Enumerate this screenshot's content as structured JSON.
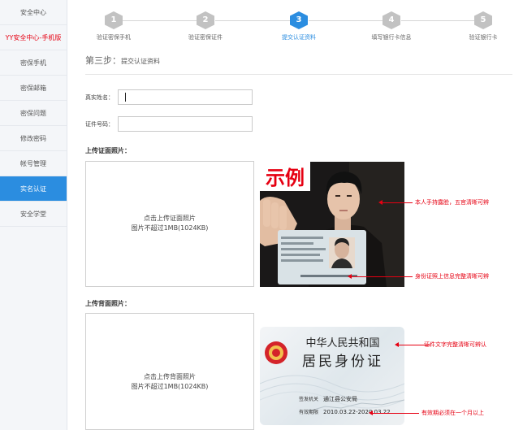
{
  "sidebar": {
    "items": [
      {
        "label": "安全中心"
      },
      {
        "label": "YY安全中心-手机版"
      },
      {
        "label": "密保手机"
      },
      {
        "label": "密保邮箱"
      },
      {
        "label": "密保问题"
      },
      {
        "label": "修改密码"
      },
      {
        "label": "帐号管理"
      },
      {
        "label": "实名认证"
      },
      {
        "label": "安全学堂"
      }
    ],
    "active_index": 7
  },
  "stepper": {
    "steps": [
      {
        "num": "1",
        "label": "验证密保手机"
      },
      {
        "num": "2",
        "label": "验证密保证件"
      },
      {
        "num": "3",
        "label": "提交认证资料"
      },
      {
        "num": "4",
        "label": "填写银行卡信息"
      },
      {
        "num": "5",
        "label": "验证银行卡"
      }
    ],
    "current_step": 3
  },
  "page": {
    "title_main": "第三步：",
    "title_sub": "提交认证资料"
  },
  "form": {
    "name_label": "真实姓名：",
    "name_value": "",
    "id_label": "证件号码：",
    "id_value": ""
  },
  "front": {
    "section_label": "上传证面照片：",
    "box_line1": "点击上传证面照片",
    "box_line2": "图片不超过1MB(1024KB)",
    "sample_stamp": "示例",
    "annotation_top": "本人手持露脸，五官清晰可辨",
    "annotation_bottom": "身份证照上信息完整清晰可辨"
  },
  "back": {
    "section_label": "上传背面照片：",
    "box_line1": "点击上传背面照片",
    "box_line2": "图片不超过1MB(1024KB)",
    "card_title1": "中华人民共和国",
    "card_title2": "居民身份证",
    "authority_label": "签发机关",
    "authority_value": "通江县公安局",
    "validity_label": "有效期限",
    "validity_value": "2010.03.22-2020.03.22",
    "annotation_top": "证件文字完整清晰可辨认",
    "annotation_bottom": "有效期必须在一个月以上"
  },
  "colors": {
    "accent": "#2b8de0",
    "annotation": "#e60012",
    "step_inactive": "#c2c2c2"
  }
}
